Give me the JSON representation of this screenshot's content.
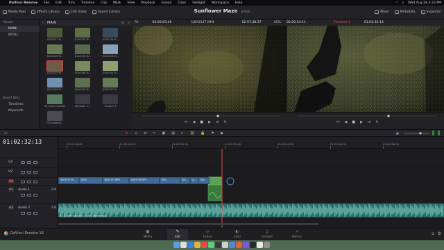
{
  "menubar": {
    "app": "DaVinci Resolve",
    "items": [
      "File",
      "Edit",
      "Trim",
      "Timeline",
      "Clip",
      "Mark",
      "View",
      "Playback",
      "Fusion",
      "Color",
      "Fairlight",
      "Workspace",
      "Help"
    ],
    "clock": "Wed Aug 28  3:23 PM"
  },
  "toolbar": {
    "media_pool": "Media Pool",
    "effects_library": "Effects Library",
    "edit_index": "Edit Index",
    "sound_library": "Sound Library",
    "project_title": "Sunflower Maze",
    "edited": "Edited",
    "mixer": "Mixer",
    "metadata": "Metadata",
    "inspector": "Inspector"
  },
  "sidebar": {
    "master_label": "Master",
    "bins": [
      "MAIN",
      "BROLL"
    ],
    "smart_bins": "Smart Bins",
    "smart_items": [
      "Timelines",
      "Keywords"
    ],
    "current_bin": "MAIN"
  },
  "pool": {
    "clips": [
      {
        "label": "1J0A3157.M...",
        "color": "#4a5a38"
      },
      {
        "label": "1J0A3145.M...",
        "color": "#5c6e44"
      },
      {
        "label": "1J0A3133.M...",
        "color": "#3a4a5a"
      },
      {
        "label": "1J0A3160.M...",
        "color": "#6a7a55"
      },
      {
        "label": "1J0A3142.M...",
        "color": "#58684c"
      },
      {
        "label": "1J0A3154.M...",
        "color": "#8aa0b8"
      },
      {
        "label": "1J0A3135.M...",
        "color": "#6e5c48"
      },
      {
        "label": "1J0A3168.M...",
        "color": "#7a8a60"
      },
      {
        "label": "1J0A3161.M...",
        "color": "#8e9e70"
      },
      {
        "label": "1J0A3156.M...",
        "color": "#7090b0"
      },
      {
        "label": "1J0A3163.M...",
        "color": "#5e6e50"
      },
      {
        "label": "1J0A3147.M...",
        "color": "#6a7a58"
      },
      {
        "label": "03_Scone Cookies - Dusty D...",
        "color": "#5a7a60"
      },
      {
        "label": "Stillwater 1...",
        "color": "#3a3a40"
      },
      {
        "label": "Timeline 1",
        "color": "#3a3a40"
      },
      {
        "label": "YTDoubleMe...",
        "color": "#4a4a52"
      }
    ]
  },
  "viewer": {
    "fit": "Fit",
    "src_tc": "00:00:03:46",
    "clip_name": "1J0A3157.MP4",
    "src_dur": "02:57:38:37",
    "zoom": "45%",
    "rec_tc": "00:00:34:11",
    "timeline_name": "Timeline 1",
    "rec_tc2": "01:02:32:13"
  },
  "timeline": {
    "tc": "01:02:32:13",
    "ruler": [
      "01:02:08:00",
      "01:02:16:00",
      "01:02:24:00",
      "01:02:32:00",
      "01:02:40:00",
      "01:02:48:00",
      "01:02:56:00"
    ],
    "tracks": [
      {
        "name": "V3"
      },
      {
        "name": "V2"
      },
      {
        "name": "V1"
      },
      {
        "name": "A1",
        "label": "Audio 1",
        "level": "2.0"
      },
      {
        "name": "A2",
        "label": "Audio 2",
        "level": "2.0"
      }
    ],
    "vclips": [
      "1J0A3157.M...",
      "1J0A3...",
      "1J0A3153.MP4",
      "1J0A3158.MP4",
      "1J0A...",
      "1J0...",
      "1J...",
      "1J0A..."
    ],
    "audio_clip": "03_Scone Cookies - Dusty Decks.mp3"
  },
  "pages": {
    "items": [
      "Media",
      "Edit",
      "Fusion",
      "Color",
      "Fairlight",
      "Deliver"
    ],
    "active": "Edit",
    "version": "DaVinci Resolve 16"
  },
  "colors": {
    "accent": "#e24a4a",
    "clip_blue": "#3f6b9a",
    "audio_teal": "#3a8a86",
    "audio_green": "#2e8a3a"
  }
}
